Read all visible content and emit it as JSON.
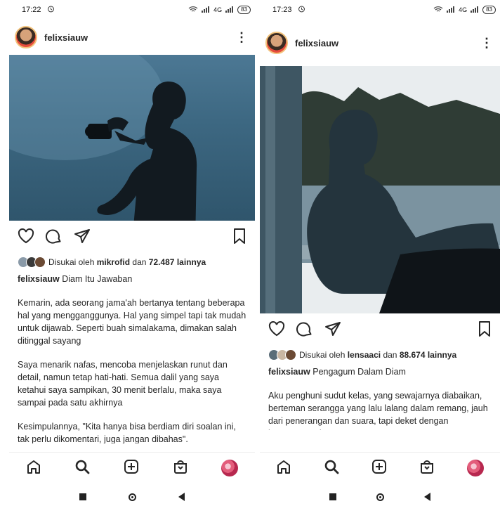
{
  "screens": [
    {
      "status": {
        "time": "17:22",
        "alarm_icon": "alarm-icon",
        "network": "4G",
        "battery": "83"
      },
      "post": {
        "username": "felixsiauw",
        "liked_prefix": "Disukai oleh",
        "liked_user": "mikrofid",
        "liked_middle": "dan",
        "liked_count": "72.487 lainnya",
        "caption_user": "felixsiauw",
        "caption_title": "Diam Itu Jawaban",
        "paragraphs": [
          "Kemarin, ada seorang jama'ah bertanya tentang beberapa hal yang mengganggunya. Hal yang simpel tapi tak mudah untuk dijawab. Seperti buah simalakama, dimakan salah ditinggal sayang",
          "Saya menarik nafas, mencoba menjelaskan runut dan detail, namun tetap hati-hati. Semua dalil yang saya ketahui saya sampikan, 30 menit berlalu, maka saya sampai pada satu akhirnya",
          "Kesimpulannya, \"Kita hanya bisa berdiam diri soalan ini, tak perlu dikomentari, juga jangan dibahas\"."
        ]
      }
    },
    {
      "status": {
        "time": "17:23",
        "alarm_icon": "alarm-icon",
        "network": "4G",
        "battery": "83"
      },
      "post": {
        "username": "felixsiauw",
        "liked_prefix": "Disukai oleh",
        "liked_user": "lensaaci",
        "liked_middle": "dan",
        "liked_count": "88.674 lainnya",
        "caption_user": "felixsiauw",
        "caption_title": "Pengagum Dalam Diam",
        "paragraphs": [
          "Aku penghuni sudut kelas, yang sewajarnya diabaikan, berteman serangga yang lalu lalang dalam remang, jauh dari penerangan dan suara, tapi deket dengan ketenangan dan rasa aman"
        ]
      }
    }
  ]
}
